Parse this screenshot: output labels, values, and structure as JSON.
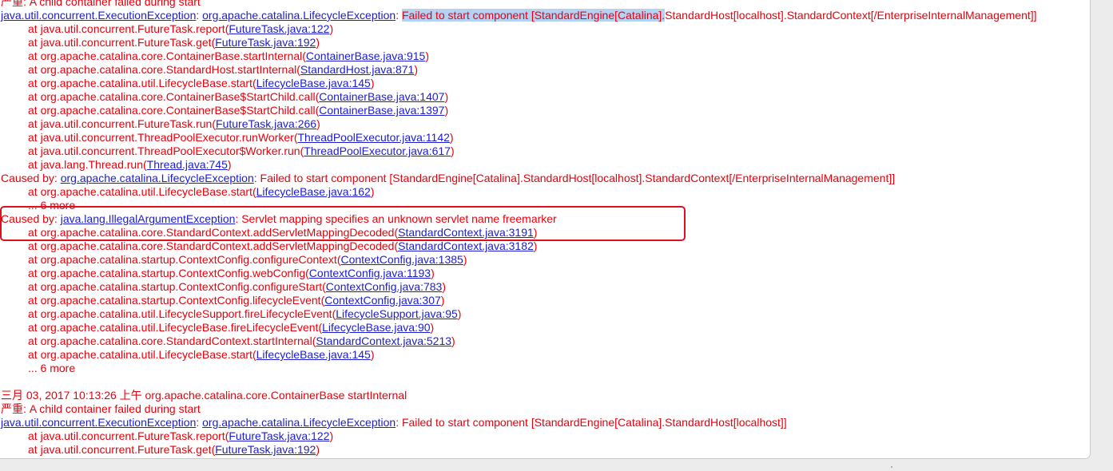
{
  "log": {
    "block1": {
      "prefix": "严重: A child container failed during start",
      "exception_class": "java.util.concurrent.ExecutionException",
      "sep1": ": ",
      "cause_class": "org.apache.catalina.LifecycleException",
      "sep2": ": ",
      "message_selected": "Failed to start component [StandardEngine[Catalina].",
      "message_rest": "StandardHost[localhost].StandardContext[/EnterpriseInternalManagement]]",
      "frames": [
        {
          "method": "java.util.concurrent.FutureTask.report",
          "source": "FutureTask.java:122"
        },
        {
          "method": "java.util.concurrent.FutureTask.get",
          "source": "FutureTask.java:192"
        },
        {
          "method": "org.apache.catalina.core.ContainerBase.startInternal",
          "source": "ContainerBase.java:915"
        },
        {
          "method": "org.apache.catalina.core.StandardHost.startInternal",
          "source": "StandardHost.java:871"
        },
        {
          "method": "org.apache.catalina.util.LifecycleBase.start",
          "source": "LifecycleBase.java:145"
        },
        {
          "method": "org.apache.catalina.core.ContainerBase$StartChild.call",
          "source": "ContainerBase.java:1407"
        },
        {
          "method": "org.apache.catalina.core.ContainerBase$StartChild.call",
          "source": "ContainerBase.java:1397"
        },
        {
          "method": "java.util.concurrent.FutureTask.run",
          "source": "FutureTask.java:266"
        },
        {
          "method": "java.util.concurrent.ThreadPoolExecutor.runWorker",
          "source": "ThreadPoolExecutor.java:1142"
        },
        {
          "method": "java.util.concurrent.ThreadPoolExecutor$Worker.run",
          "source": "ThreadPoolExecutor.java:617"
        },
        {
          "method": "java.lang.Thread.run",
          "source": "Thread.java:745"
        }
      ],
      "caused_by_1": {
        "label": "Caused by: ",
        "cls": "org.apache.catalina.LifecycleException",
        "msg": ": Failed to start component [StandardEngine[Catalina].StandardHost[localhost].StandardContext[/EnterpriseInternalManagement]]",
        "frame": {
          "method": "org.apache.catalina.util.LifecycleBase.start",
          "source": "LifecycleBase.java:162"
        },
        "more": "... 6 more"
      },
      "caused_by_2": {
        "label": "Caused by: ",
        "cls": "java.lang.IllegalArgumentException",
        "msg": ": Servlet mapping specifies an unknown servlet name freemarker",
        "frames": [
          {
            "method": "org.apache.catalina.core.StandardContext.addServletMappingDecoded",
            "source": "StandardContext.java:3191"
          },
          {
            "method": "org.apache.catalina.core.StandardContext.addServletMappingDecoded",
            "source": "StandardContext.java:3182"
          },
          {
            "method": "org.apache.catalina.startup.ContextConfig.configureContext",
            "source": "ContextConfig.java:1385"
          },
          {
            "method": "org.apache.catalina.startup.ContextConfig.webConfig",
            "source": "ContextConfig.java:1193"
          },
          {
            "method": "org.apache.catalina.startup.ContextConfig.configureStart",
            "source": "ContextConfig.java:783"
          },
          {
            "method": "org.apache.catalina.startup.ContextConfig.lifecycleEvent",
            "source": "ContextConfig.java:307"
          },
          {
            "method": "org.apache.catalina.util.LifecycleSupport.fireLifecycleEvent",
            "source": "LifecycleSupport.java:95"
          },
          {
            "method": "org.apache.catalina.util.LifecycleBase.fireLifecycleEvent",
            "source": "LifecycleBase.java:90"
          },
          {
            "method": "org.apache.catalina.core.StandardContext.startInternal",
            "source": "StandardContext.java:5213"
          },
          {
            "method": "org.apache.catalina.util.LifecycleBase.start",
            "source": "LifecycleBase.java:145"
          }
        ],
        "more": "... 6 more"
      }
    },
    "block2": {
      "timestamp": "三月 03, 2017 10:13:26 上午 org.apache.catalina.core.ContainerBase startInternal",
      "prefix": "严重: A child container failed during start",
      "exception_class": "java.util.concurrent.ExecutionException",
      "sep1": ": ",
      "cause_class": "org.apache.catalina.LifecycleException",
      "msg": ": Failed to start component [StandardEngine[Catalina].StandardHost[localhost]]",
      "frames": [
        {
          "method": "java.util.concurrent.FutureTask.report",
          "source": "FutureTask.java:122"
        },
        {
          "method": "java.util.concurrent.FutureTask.get",
          "source": "FutureTask.java:192"
        }
      ]
    },
    "frame_prefix": "at ",
    "paren_open": "(",
    "paren_close": ")"
  },
  "colors": {
    "text": "#e8000c",
    "link": "#1c1cd0",
    "selection": "#b3d3f5",
    "highlight_border": "#e00f1f"
  }
}
